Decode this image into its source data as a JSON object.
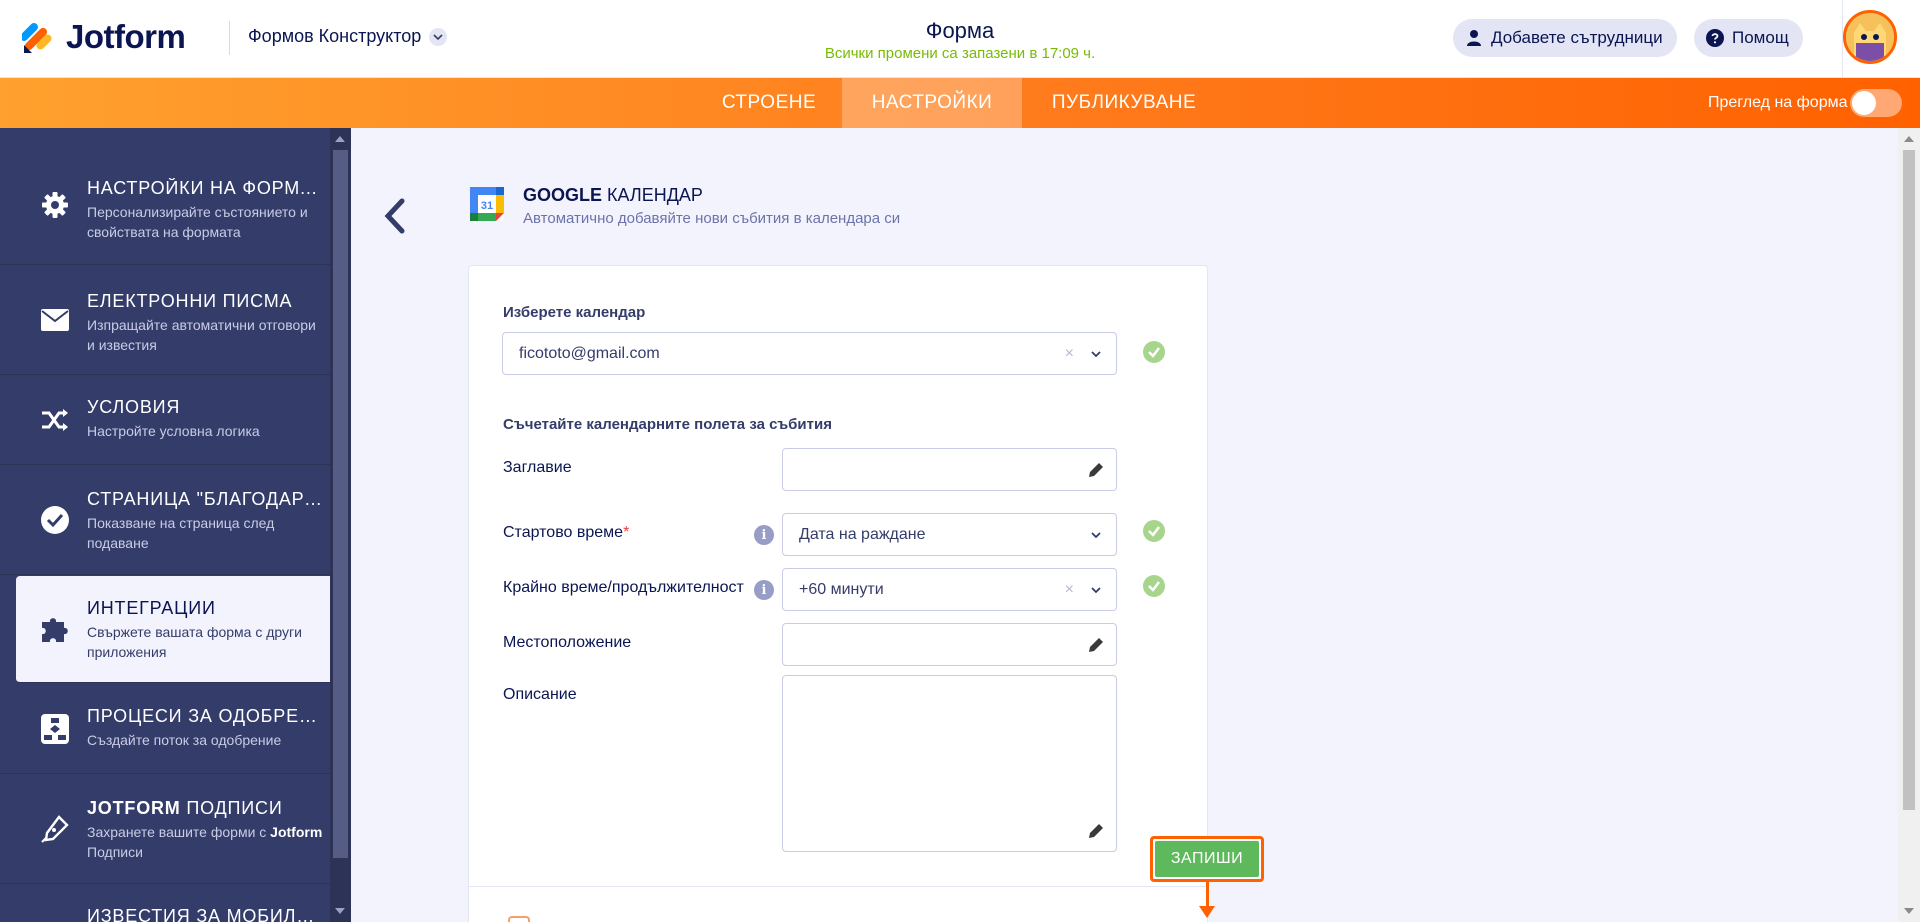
{
  "header": {
    "logo_text": "Jotform",
    "builder_label": "Формов Конструктор",
    "form_title": "Форма",
    "save_status": "Всички промени са запазени в 17:09 ч.",
    "add_collaborators": "Добавете сътрудници",
    "help": "Помощ"
  },
  "nav": {
    "tabs": [
      {
        "label": "СТРОЕНЕ"
      },
      {
        "label": "НАСТРОЙКИ"
      },
      {
        "label": "ПУБЛИКУВАНЕ"
      }
    ],
    "preview_label": "Преглед на форма"
  },
  "sidebar": {
    "items": [
      {
        "title": "НАСТРОЙКИ НА ФОРМ...",
        "desc": "Персонализирайте състоянието и свойствата на формата",
        "icon": "gear-icon"
      },
      {
        "title": "ЕЛЕКТРОННИ ПИСМА",
        "desc": "Изпращайте автоматични отговори и известия",
        "icon": "envelope-icon"
      },
      {
        "title": "УСЛОВИЯ",
        "desc": "Настройте условна логика",
        "icon": "shuffle-icon"
      },
      {
        "title": "СТРАНИЦА \"БЛАГОДАРЯ\"",
        "desc": "Показване на страница след подаване",
        "icon": "check-circle-icon"
      },
      {
        "title": "ИНТЕГРАЦИИ",
        "desc": "Свържете вашата форма с други приложения",
        "icon": "puzzle-icon"
      },
      {
        "title": "ПРОЦЕСИ ЗА ОДОБРЕН...",
        "desc": "Създайте поток за одобрение",
        "icon": "flow-icon"
      },
      {
        "title_bold": "JOTFORM",
        "title_rest": " ПОДПИСИ",
        "desc_pre": "Захранете вашите форми с ",
        "desc_bold": "Jotform",
        "desc_post": " Подписи",
        "icon": "pen-icon"
      },
      {
        "title": "ИЗВЕСТИЯ ЗА МОБИЛН...",
        "desc": "",
        "icon": "bell-icon"
      }
    ]
  },
  "integration": {
    "title_bold": "GOOGLE",
    "title_rest": " КАЛЕНДАР",
    "subtitle": "Автоматично добавяйте нови събития в календара си",
    "icon_number": "31",
    "select_calendar_label": "Изберете календар",
    "selected_calendar": "ficototo@gmail.com",
    "map_fields_label": "Съчетайте календарните полета за събития",
    "fields": {
      "title_label": "Заглавие",
      "start_label": "Стартово време",
      "start_required": "*",
      "start_value": "Дата на раждане",
      "end_label": "Крайно време/продължителност",
      "end_value": "+60 минути",
      "location_label": "Местоположение",
      "description_label": "Описание"
    },
    "clear_symbol": "×",
    "info_symbol": "i",
    "save_label": "ЗАПИШИ"
  }
}
